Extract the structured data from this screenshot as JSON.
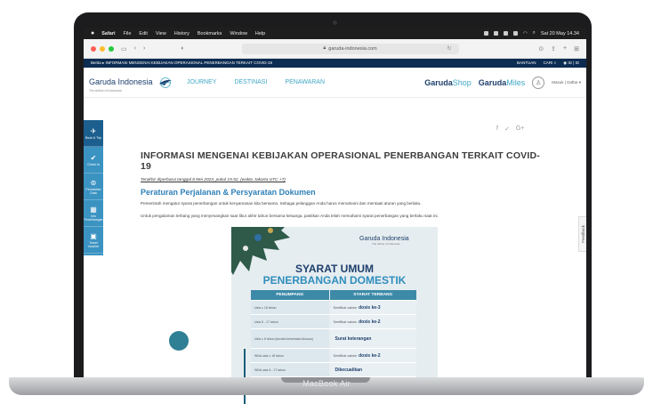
{
  "menubar": {
    "app": "Safari",
    "items": [
      "File",
      "Edit",
      "View",
      "History",
      "Bookmarks",
      "Window",
      "Help"
    ],
    "clock": "Sat 20 May 14.34"
  },
  "browser": {
    "url": "garuda-indonesia.com"
  },
  "topstrip": {
    "breadcrumb": "Berita ▸ INFORMASI MENGENAI KEBIJAKAN OPERASIONAL PENERBANGAN TERKAIT COVID-19",
    "help": "BANTUAN",
    "search": "CARI",
    "lang": "ID | ID"
  },
  "header": {
    "logo": "Garuda Indonesia",
    "logo_sub": "The Airline of Indonesia",
    "nav": [
      "JOURNEY",
      "DESTINASI",
      "PENAWARAN"
    ],
    "shop_bold": "Garuda",
    "shop_light": "Shop",
    "miles_bold": "Garuda",
    "miles_light": "Miles",
    "login": "Masuk | Daftar"
  },
  "sidebar": {
    "items": [
      {
        "icon": "plane-icon",
        "label": "Book & Trip"
      },
      {
        "icon": "check-icon",
        "label": "Check In"
      },
      {
        "icon": "settings-icon",
        "label": "Perubahan Data"
      },
      {
        "icon": "calendar-icon",
        "label": "Info Penerbangan"
      },
      {
        "icon": "suitcase-icon",
        "label": "Travel Voucher"
      }
    ]
  },
  "share": [
    "f",
    "✓",
    "G+"
  ],
  "article": {
    "title": "INFORMASI MENGENAI KEBIJAKAN OPERASIONAL PENERBANGAN TERKAIT COVID-19",
    "updated": "Terakhir diperbarui tanggal 8 Mei 2023, pukul 15.52, (waktu Jakarta UTC +7)",
    "subtitle": "Peraturan Perjalanan & Persyaratan Dokumen",
    "para1": "Pemerintah mengatur syarat penerbangan untuk kenyamanan kita bersama. Sebagai pelanggan Anda harus memahami dan mentaati aturan yang berlaku.",
    "para2": "Untuk pengalaman terbang yang menyenangkan saat libur akhir tahun bersama keluarga, pastikan Anda telah memahami syarat penerbangan yang berlaku saat ini."
  },
  "feedback": "Feedback",
  "poster": {
    "logo": "Garuda Indonesia",
    "logo_sub": "The Airline of Indonesia",
    "heading1": "SYARAT UMUM",
    "heading2": "PENERBANGAN DOMESTIK",
    "col1": "PENUMPANG",
    "col2": "SYARAT TERBANG",
    "rows": [
      {
        "who": "Usia ≥ 18 tahun",
        "req": "Sertifikat vaksin",
        "req_bold": "dosis ke-3"
      },
      {
        "who": "Usia 6 - 17 tahun",
        "req": "Sertifikat vaksin",
        "req_bold": "dosis ke-2"
      },
      {
        "who": "Usia ≥ 6 tahun (kondisi kesehatan khusus)",
        "req": "",
        "req_bold": "Surat keterangan"
      },
      {
        "who": "WNA usia ≥ 18 tahun",
        "req": "Sertifikat vaksin",
        "req_bold": "dosis ke-2"
      },
      {
        "who": "WNA usia 6 - 17 tahun",
        "req": "",
        "req_bold": "Dikecualikan"
      }
    ]
  },
  "laptop": {
    "model": "MacBook Air"
  }
}
